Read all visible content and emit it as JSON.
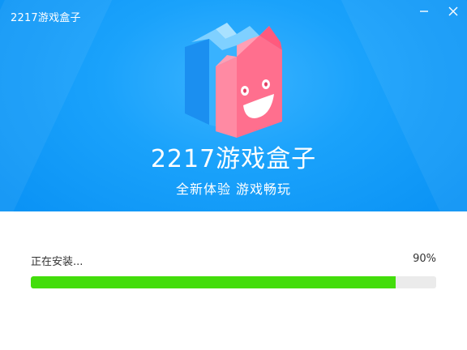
{
  "window": {
    "title": "2217游戏盒子",
    "minimize_icon": "minimize-icon",
    "close_icon": "close-icon"
  },
  "hero": {
    "logo_icon": "cube-mascot-logo",
    "brand_name": "2217游戏盒子",
    "slogan": "全新体验 游戏畅玩"
  },
  "install": {
    "status_text": "正在安装...",
    "percent_text": "90%",
    "progress": 0.9
  },
  "colors": {
    "hero_blue": "#1aa2fb",
    "progress_green": "#43dd0b",
    "track_gray": "#ebebeb",
    "cube_pink": "#ff6f8e",
    "cube_blue": "#2ca8ff"
  }
}
